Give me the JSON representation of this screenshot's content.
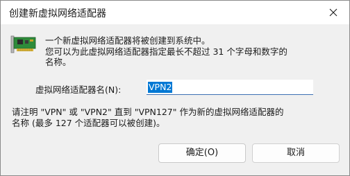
{
  "window": {
    "title": "创建新虚拟网络适配器"
  },
  "intro": {
    "lines": [
      "一个新虚拟网络适配器将被创建到系统中。",
      "您可以为此虚拟网络适配器指定最长不超过 31 个字母和数字的",
      "名称。"
    ]
  },
  "name_field": {
    "label": "虚拟网络适配器名(N):",
    "value": "VPN2"
  },
  "hint": {
    "lines": [
      "请注明 \"VPN\" 或 \"VPN2\" 直到 \"VPN127\" 作为新的虚拟网络适配器的",
      "名称 (最多 127 个适配器可以被创建)。"
    ]
  },
  "buttons": {
    "ok_label": "确定(O)",
    "cancel_label": "取消"
  },
  "colors": {
    "selection": "#0078d4",
    "input_underline": "#3b6fb3"
  },
  "icons": {
    "dialog_icon": "network-card-icon",
    "close": "close-icon"
  }
}
